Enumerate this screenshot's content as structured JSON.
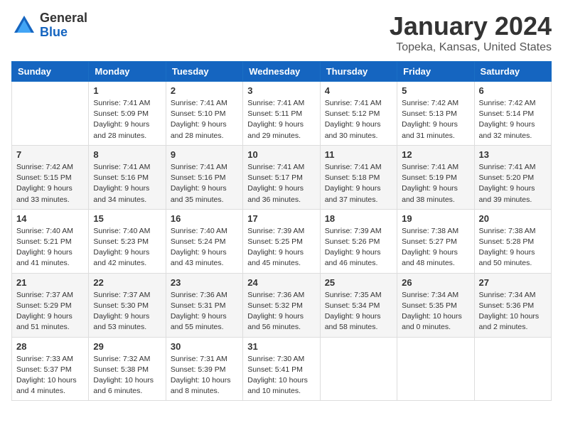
{
  "logo": {
    "general": "General",
    "blue": "Blue"
  },
  "header": {
    "month": "January 2024",
    "location": "Topeka, Kansas, United States"
  },
  "weekdays": [
    "Sunday",
    "Monday",
    "Tuesday",
    "Wednesday",
    "Thursday",
    "Friday",
    "Saturday"
  ],
  "weeks": [
    [
      {
        "day": "",
        "content": ""
      },
      {
        "day": "1",
        "content": "Sunrise: 7:41 AM\nSunset: 5:09 PM\nDaylight: 9 hours\nand 28 minutes."
      },
      {
        "day": "2",
        "content": "Sunrise: 7:41 AM\nSunset: 5:10 PM\nDaylight: 9 hours\nand 28 minutes."
      },
      {
        "day": "3",
        "content": "Sunrise: 7:41 AM\nSunset: 5:11 PM\nDaylight: 9 hours\nand 29 minutes."
      },
      {
        "day": "4",
        "content": "Sunrise: 7:41 AM\nSunset: 5:12 PM\nDaylight: 9 hours\nand 30 minutes."
      },
      {
        "day": "5",
        "content": "Sunrise: 7:42 AM\nSunset: 5:13 PM\nDaylight: 9 hours\nand 31 minutes."
      },
      {
        "day": "6",
        "content": "Sunrise: 7:42 AM\nSunset: 5:14 PM\nDaylight: 9 hours\nand 32 minutes."
      }
    ],
    [
      {
        "day": "7",
        "content": "Sunrise: 7:42 AM\nSunset: 5:15 PM\nDaylight: 9 hours\nand 33 minutes."
      },
      {
        "day": "8",
        "content": "Sunrise: 7:41 AM\nSunset: 5:16 PM\nDaylight: 9 hours\nand 34 minutes."
      },
      {
        "day": "9",
        "content": "Sunrise: 7:41 AM\nSunset: 5:16 PM\nDaylight: 9 hours\nand 35 minutes."
      },
      {
        "day": "10",
        "content": "Sunrise: 7:41 AM\nSunset: 5:17 PM\nDaylight: 9 hours\nand 36 minutes."
      },
      {
        "day": "11",
        "content": "Sunrise: 7:41 AM\nSunset: 5:18 PM\nDaylight: 9 hours\nand 37 minutes."
      },
      {
        "day": "12",
        "content": "Sunrise: 7:41 AM\nSunset: 5:19 PM\nDaylight: 9 hours\nand 38 minutes."
      },
      {
        "day": "13",
        "content": "Sunrise: 7:41 AM\nSunset: 5:20 PM\nDaylight: 9 hours\nand 39 minutes."
      }
    ],
    [
      {
        "day": "14",
        "content": "Sunrise: 7:40 AM\nSunset: 5:21 PM\nDaylight: 9 hours\nand 41 minutes."
      },
      {
        "day": "15",
        "content": "Sunrise: 7:40 AM\nSunset: 5:23 PM\nDaylight: 9 hours\nand 42 minutes."
      },
      {
        "day": "16",
        "content": "Sunrise: 7:40 AM\nSunset: 5:24 PM\nDaylight: 9 hours\nand 43 minutes."
      },
      {
        "day": "17",
        "content": "Sunrise: 7:39 AM\nSunset: 5:25 PM\nDaylight: 9 hours\nand 45 minutes."
      },
      {
        "day": "18",
        "content": "Sunrise: 7:39 AM\nSunset: 5:26 PM\nDaylight: 9 hours\nand 46 minutes."
      },
      {
        "day": "19",
        "content": "Sunrise: 7:38 AM\nSunset: 5:27 PM\nDaylight: 9 hours\nand 48 minutes."
      },
      {
        "day": "20",
        "content": "Sunrise: 7:38 AM\nSunset: 5:28 PM\nDaylight: 9 hours\nand 50 minutes."
      }
    ],
    [
      {
        "day": "21",
        "content": "Sunrise: 7:37 AM\nSunset: 5:29 PM\nDaylight: 9 hours\nand 51 minutes."
      },
      {
        "day": "22",
        "content": "Sunrise: 7:37 AM\nSunset: 5:30 PM\nDaylight: 9 hours\nand 53 minutes."
      },
      {
        "day": "23",
        "content": "Sunrise: 7:36 AM\nSunset: 5:31 PM\nDaylight: 9 hours\nand 55 minutes."
      },
      {
        "day": "24",
        "content": "Sunrise: 7:36 AM\nSunset: 5:32 PM\nDaylight: 9 hours\nand 56 minutes."
      },
      {
        "day": "25",
        "content": "Sunrise: 7:35 AM\nSunset: 5:34 PM\nDaylight: 9 hours\nand 58 minutes."
      },
      {
        "day": "26",
        "content": "Sunrise: 7:34 AM\nSunset: 5:35 PM\nDaylight: 10 hours\nand 0 minutes."
      },
      {
        "day": "27",
        "content": "Sunrise: 7:34 AM\nSunset: 5:36 PM\nDaylight: 10 hours\nand 2 minutes."
      }
    ],
    [
      {
        "day": "28",
        "content": "Sunrise: 7:33 AM\nSunset: 5:37 PM\nDaylight: 10 hours\nand 4 minutes."
      },
      {
        "day": "29",
        "content": "Sunrise: 7:32 AM\nSunset: 5:38 PM\nDaylight: 10 hours\nand 6 minutes."
      },
      {
        "day": "30",
        "content": "Sunrise: 7:31 AM\nSunset: 5:39 PM\nDaylight: 10 hours\nand 8 minutes."
      },
      {
        "day": "31",
        "content": "Sunrise: 7:30 AM\nSunset: 5:41 PM\nDaylight: 10 hours\nand 10 minutes."
      },
      {
        "day": "",
        "content": ""
      },
      {
        "day": "",
        "content": ""
      },
      {
        "day": "",
        "content": ""
      }
    ]
  ]
}
